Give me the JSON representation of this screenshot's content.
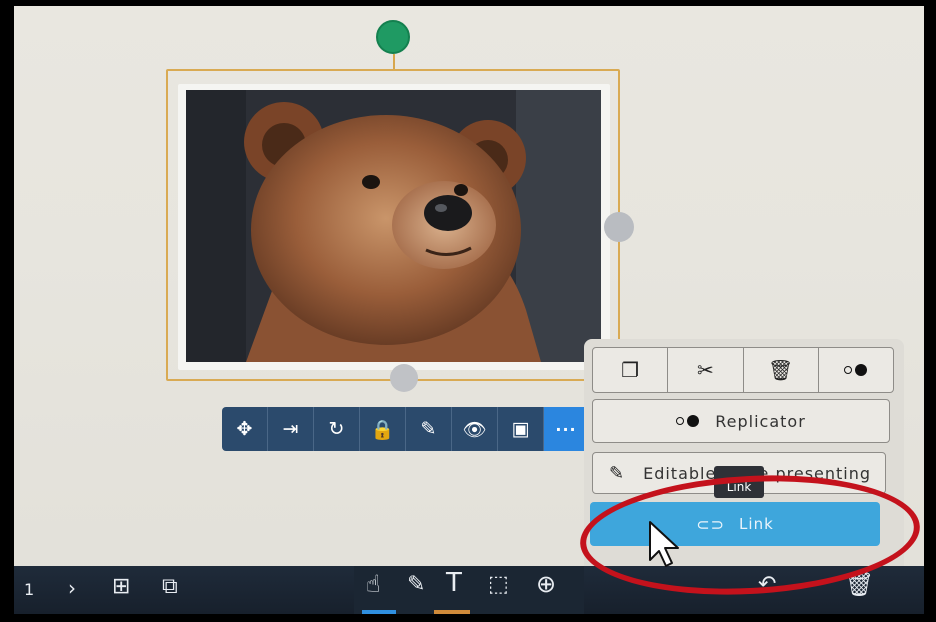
{
  "object_toolbar": {
    "buttons": [
      {
        "name": "move",
        "icon": "move-icon",
        "glyph": "✥"
      },
      {
        "name": "send-to",
        "icon": "enter-icon",
        "glyph": "⇥"
      },
      {
        "name": "rotate",
        "icon": "rotate-icon",
        "glyph": "↻"
      },
      {
        "name": "lock",
        "icon": "lock-icon",
        "glyph": "🔒"
      },
      {
        "name": "erase",
        "icon": "no-ink-icon",
        "glyph": "✎"
      },
      {
        "name": "visibility",
        "icon": "eye-icon",
        "glyph": "👁"
      },
      {
        "name": "group",
        "icon": "frame-icon",
        "glyph": "▣"
      },
      {
        "name": "more",
        "icon": "more-icon",
        "glyph": "···"
      }
    ]
  },
  "more_panel": {
    "icon_row": [
      {
        "icon": "duplicate-icon",
        "glyph": "❐"
      },
      {
        "icon": "scissors-icon",
        "glyph": "✂"
      },
      {
        "icon": "trash-icon",
        "glyph": "🗑"
      },
      {
        "icon": "replicator-toggle-icon",
        "glyph": "○●"
      }
    ],
    "replicator_label": "Replicator",
    "editable_label": "Editable while presenting",
    "link_label": "Link",
    "tooltip": "Link"
  },
  "bottom_bar": {
    "page_number": "1",
    "next_glyph": "›",
    "add_page_glyph": "⊞",
    "copy_glyph": "⧉",
    "hand_glyph": "☝",
    "pen_glyph": "✎",
    "text_glyph": "T",
    "select_glyph": "⬚",
    "plus_glyph": "⊕",
    "undo_glyph": "↶",
    "trash_glyph": "🗑"
  },
  "colors": {
    "toolbar_bg": "#2b4a6c",
    "more_button": "#2b86df",
    "link_button": "#3ea6dc",
    "selection_border": "#d9aa53",
    "rotate_handle": "#1f9a63",
    "annotation_ring": "#c4121c"
  }
}
